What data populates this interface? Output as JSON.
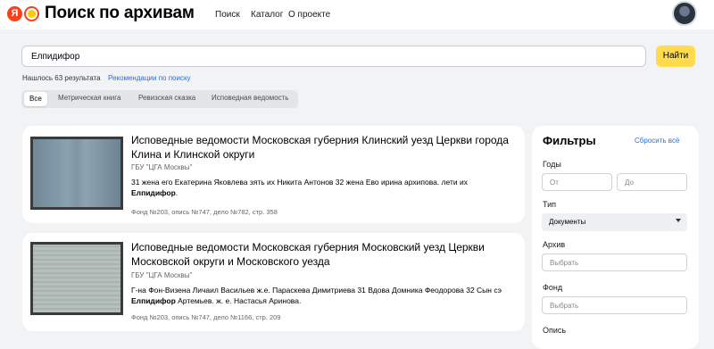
{
  "header": {
    "logo_ya": "Я",
    "brand": "Поиск по архивам",
    "nav": [
      "Поиск",
      "Каталог",
      "О проекте"
    ]
  },
  "search": {
    "value": "Елпидифор",
    "button": "Найти",
    "found": "Нашлось 63 результата",
    "recommendations": "Рекомендации по поиску"
  },
  "tabs": [
    "Все",
    "Метрическая книга",
    "Ревизская сказка",
    "Исповедная ведомость"
  ],
  "results": [
    {
      "title": "Исповедные ведомости Московская губерния Клинский уезд Церкви города Клина и Клинской округи",
      "source": "ГБУ \"ЦГА Москвы\"",
      "snippet_before": "31 жена его Екатерина Яковлева зять их Никита Антонов 32 жена Ево ирина архипова. лети их ",
      "snippet_highlight": "Елпидифор",
      "snippet_after": ".",
      "meta": "Фонд №203, опись №747, дело №782, стр. 358"
    },
    {
      "title": "Исповедные ведомости Московская губерния Московский уезд Церкви Московской округи и Московского уезда",
      "source": "ГБУ \"ЦГА Москвы\"",
      "snippet_before": "Г-на Фон-Визена Личаил Васильев ж.е. Параскева Димитриева 31 Вдова Домника Феодорова 32 Сын сэ ",
      "snippet_highlight": "Елпидифор",
      "snippet_after": " Артемьев. ж. е. Настасья Аринова.",
      "meta": "Фонд №203, опись №747, дело №1166, стр. 209"
    }
  ],
  "filters": {
    "title": "Фильтры",
    "reset": "Сбросить всё",
    "years_label": "Годы",
    "from_placeholder": "От",
    "to_placeholder": "До",
    "type_label": "Тип",
    "type_value": "Документы",
    "archive_label": "Архив",
    "archive_placeholder": "Выбрать",
    "fond_label": "Фонд",
    "fond_placeholder": "Выбрать",
    "opis_label": "Опись"
  }
}
